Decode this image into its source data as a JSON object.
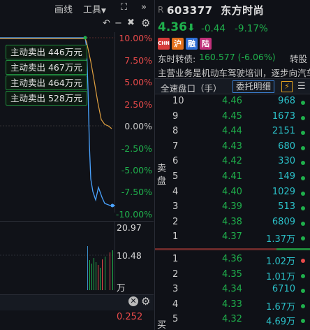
{
  "chart": {
    "toolbar": {
      "draw_label": "画线",
      "tools_label": "工具"
    },
    "pct_axis": [
      "10.00%",
      "7.50%",
      "5.00%",
      "2.50%",
      "0.00%",
      "-2.50%",
      "-5.00%",
      "-7.50%",
      "-10.00%"
    ],
    "trade_tags": [
      "主动卖出 446万元",
      "主动卖出 467万元",
      "主动卖出 464万元",
      "主动卖出 528万元"
    ],
    "volume_axis": {
      "top": "20.97",
      "mid": "10.48",
      "unit": "万"
    },
    "indicator_value": "0.252",
    "colors": {
      "up": "#e84a4a",
      "down": "#1fb04c",
      "price_line": "#4aa3ff",
      "avg_line": "#e0a040"
    }
  },
  "quote": {
    "r_tag": "R",
    "code": "603377",
    "name": "东方时尚",
    "price": "4.36",
    "change": "-0.44",
    "change_pct": "-9.17%",
    "badges": [
      {
        "text": "CHN",
        "color": "#d63b3b"
      },
      {
        "text": "沪",
        "color": "#e0701c"
      },
      {
        "text": "融",
        "color": "#2f6fd6"
      },
      {
        "text": "陆",
        "color": "#c0307a"
      }
    ],
    "convertible": {
      "label": "东时转债:",
      "value": "160.577 (-6.06%)",
      "right": "转股"
    },
    "business": "主营业务是机动车驾驶培训，逐步向汽车服务",
    "tabs": {
      "all_book": "全速盘口（手）",
      "order_detail": "委托明细"
    },
    "sell_label": "卖盘",
    "buy_label": "买盘",
    "asks": [
      {
        "level": "10",
        "price": "4.46",
        "qty": "968"
      },
      {
        "level": "9",
        "price": "4.45",
        "qty": "1673"
      },
      {
        "level": "8",
        "price": "4.44",
        "qty": "2151"
      },
      {
        "level": "7",
        "price": "4.43",
        "qty": "680"
      },
      {
        "level": "6",
        "price": "4.42",
        "qty": "330"
      },
      {
        "level": "5",
        "price": "4.41",
        "qty": "149"
      },
      {
        "level": "4",
        "price": "4.40",
        "qty": "1029"
      },
      {
        "level": "3",
        "price": "4.39",
        "qty": "513"
      },
      {
        "level": "2",
        "price": "4.38",
        "qty": "6809"
      },
      {
        "level": "1",
        "price": "4.37",
        "qty": "1.37万"
      }
    ],
    "bids": [
      {
        "level": "1",
        "price": "4.36",
        "qty": "1.02万"
      },
      {
        "level": "2",
        "price": "4.35",
        "qty": "1.01万"
      },
      {
        "level": "3",
        "price": "4.34",
        "qty": "6710"
      },
      {
        "level": "4",
        "price": "4.33",
        "qty": "1.67万"
      },
      {
        "level": "5",
        "price": "4.32",
        "qty": "4.69万"
      }
    ]
  }
}
